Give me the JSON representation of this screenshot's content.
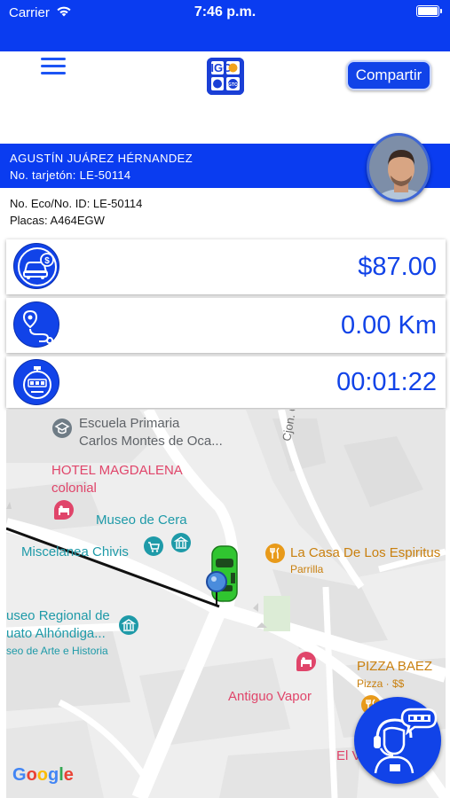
{
  "status_bar": {
    "carrier": "Carrier",
    "time": "7:46 p.m.",
    "icons": [
      "wifi-icon",
      "battery-icon"
    ]
  },
  "nav": {
    "menu_icon": "hamburger-menu-icon",
    "logo_text": "SIGO",
    "logo_subtext": "GTO",
    "share_label": "Compartir"
  },
  "driver": {
    "name": "AGUSTÍN JUÁREZ HÉRNANDEZ",
    "license": "No. tarjetón: LE-50114",
    "eco_id": "No. Eco/No. ID: LE-50114",
    "plates": "Placas: A464EGW"
  },
  "metrics": [
    {
      "icon": "taxi-fare-icon",
      "value": "$87.00"
    },
    {
      "icon": "route-distance-icon",
      "value": "0.00 Km"
    },
    {
      "icon": "stopwatch-icon",
      "value": "00:01:22"
    }
  ],
  "map": {
    "labels": {
      "school_1": "Escuela Primaria",
      "school_2": "Carlos Montes de Oca...",
      "street": "Cjon. Ch",
      "hotel_1": "HOTEL MAGDALENA",
      "hotel_2": "colonial",
      "museo_cera": "Museo de Cera",
      "miscelanea": "Miscelanea Chivis",
      "casa_espiritus": "La Casa De Los Espiritus",
      "parrilla": "Parrilla",
      "museo_regional_1": "useo Regional de",
      "museo_regional_2": "uato Alhóndiga...",
      "museo_regional_3": "seo de Arte e Historia",
      "pizza_1": "PIZZA BAEZ",
      "pizza_2": "Pizza · $$",
      "antiguo_vapor": "Antiguo Vapor",
      "el_v": "El V",
      "google": "Google"
    },
    "colors": {
      "brand": "#1143e8",
      "hotel": "#e0456a",
      "poi_teal": "#1e9aa8",
      "poi_orange": "#e89a1a",
      "poi_gray": "#6f7c86"
    }
  },
  "support_button": {
    "icon": "support-agent-taxi-icon"
  }
}
